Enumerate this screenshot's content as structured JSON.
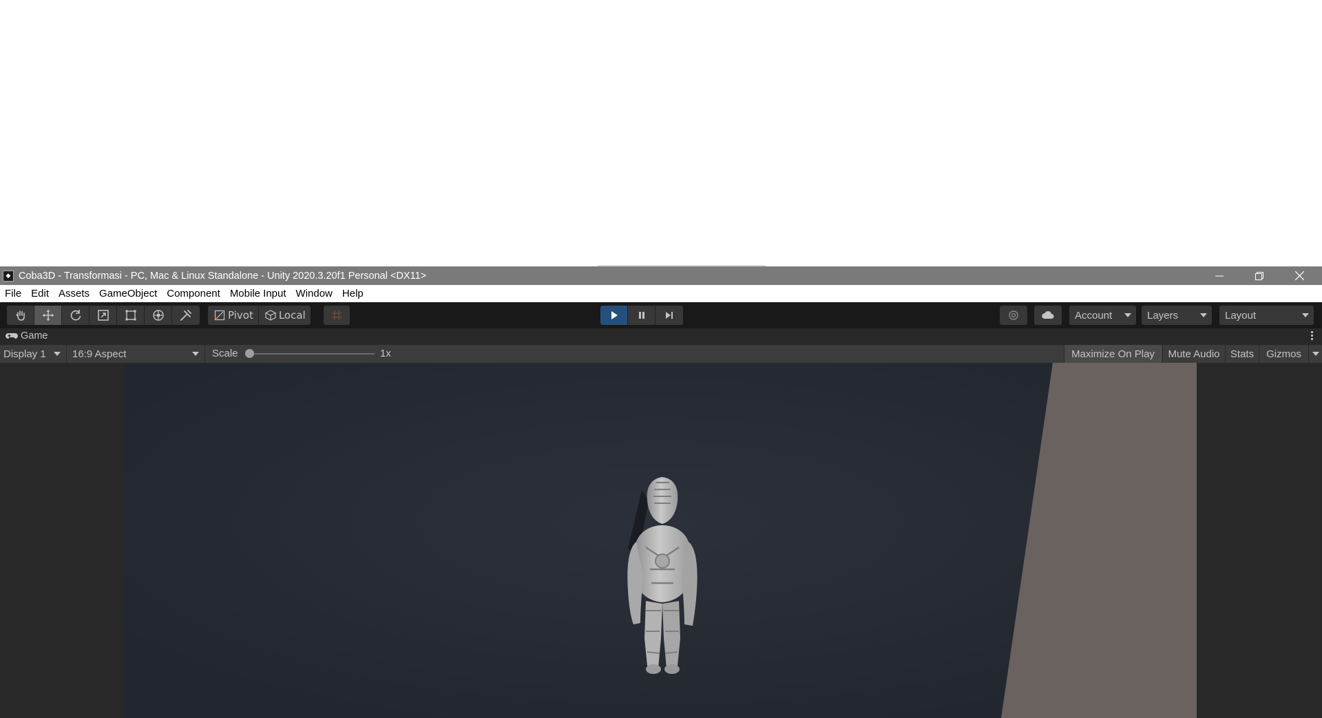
{
  "window": {
    "title": "Coba3D - Transformasi - PC, Mac & Linux Standalone - Unity 2020.3.20f1 Personal <DX11>",
    "controls": [
      "minimize-icon",
      "restore-icon",
      "close-icon"
    ]
  },
  "menu": {
    "items": [
      "File",
      "Edit",
      "Assets",
      "GameObject",
      "Component",
      "Mobile Input",
      "Window",
      "Help"
    ]
  },
  "toolbar": {
    "tools": [
      "hand-tool-icon",
      "move-tool-icon",
      "rotate-tool-icon",
      "scale-tool-icon",
      "rect-tool-icon",
      "transform-tool-icon",
      "custom-tool-icon"
    ],
    "active_tool": "move-tool-icon",
    "pivot_label": "Pivot",
    "local_label": "Local",
    "play_state": "playing",
    "account_label": "Account",
    "layers_label": "Layers",
    "layout_label": "Layout",
    "play_color": "#24507e"
  },
  "game_tab": {
    "label": "Game"
  },
  "game_bar": {
    "display_label": "Display 1",
    "aspect_label": "16:9 Aspect",
    "scale_label": "Scale",
    "scale_value": "1x",
    "maximize_label": "Maximize On Play",
    "mute_label": "Mute Audio",
    "stats_label": "Stats",
    "gizmos_label": "Gizmos"
  },
  "colors": {
    "scene_bg": "#262b34",
    "wall": "#6a625f",
    "character": "#b9b9b9"
  }
}
